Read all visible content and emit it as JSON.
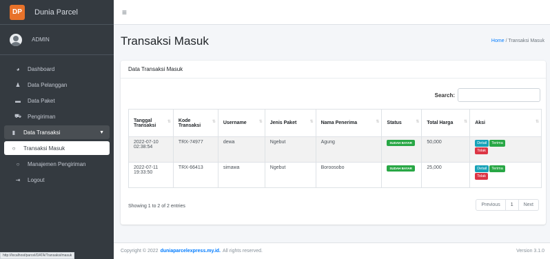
{
  "brand": {
    "name": "Dunia Parcel"
  },
  "user": {
    "name": "ADMIN"
  },
  "sidebar": {
    "items": [
      {
        "label": "Dashboard",
        "icon": "dashboard-icon"
      },
      {
        "label": "Data Pelanggan",
        "icon": "user-icon"
      },
      {
        "label": "Data Paket",
        "icon": "folder-icon"
      },
      {
        "label": "Pengiriman",
        "icon": "truck-icon"
      },
      {
        "label": "Data Transaksi",
        "icon": "document-icon"
      },
      {
        "label": "Transaksi Masuk",
        "icon": "circle-icon"
      },
      {
        "label": "Manajemen Pengiriman",
        "icon": "circle-icon"
      },
      {
        "label": "Logout",
        "icon": "logout-icon"
      }
    ]
  },
  "header": {
    "title": "Transaksi Masuk",
    "breadcrumb_home": "Home",
    "breadcrumb_sep": "/",
    "breadcrumb_current": "Transaksi Masuk"
  },
  "card": {
    "title": "Data Transaksi Masuk",
    "search_label": "Search:",
    "search_value": ""
  },
  "table": {
    "headers": [
      "Tanggal Transaksi",
      "Kode Transaksi",
      "Username",
      "Jenis Paket",
      "Nama Penerima",
      "Status",
      "Total Harga",
      "Aksi"
    ],
    "rows": [
      {
        "tanggal": "2022-07-10 02:38:54",
        "kode": "TRX-74977",
        "username": "dewa",
        "jenis": "Ngebut",
        "penerima": "Agung",
        "status": "SUDAH BAYAR",
        "total": "50,000"
      },
      {
        "tanggal": "2022-07-11 19:33:50",
        "kode": "TRX-66413",
        "username": "simawa",
        "jenis": "Ngebut",
        "penerima": "Boroosobo",
        "status": "SUDAH BAYAR",
        "total": "25,000"
      }
    ],
    "actions": {
      "detail": "Detail",
      "terima": "Terima",
      "tolak": "Tolak"
    }
  },
  "info": "Showing 1 to 2 of 2 entries",
  "pagination": {
    "previous": "Previous",
    "current": "1",
    "next": "Next"
  },
  "footer": {
    "copyright": "Copyright © 2022",
    "site": "duniaparcelexpress.my.id.",
    "rights": "All rights reserved.",
    "version": "Version 3.1.0"
  },
  "status_url": "http://localhost/parcel/DATA/Transaksi/masuk",
  "colors": {
    "sidebar": "#343a40",
    "primary": "#007bff",
    "success": "#28a745",
    "danger": "#dc3545",
    "info": "#17a2b8"
  }
}
